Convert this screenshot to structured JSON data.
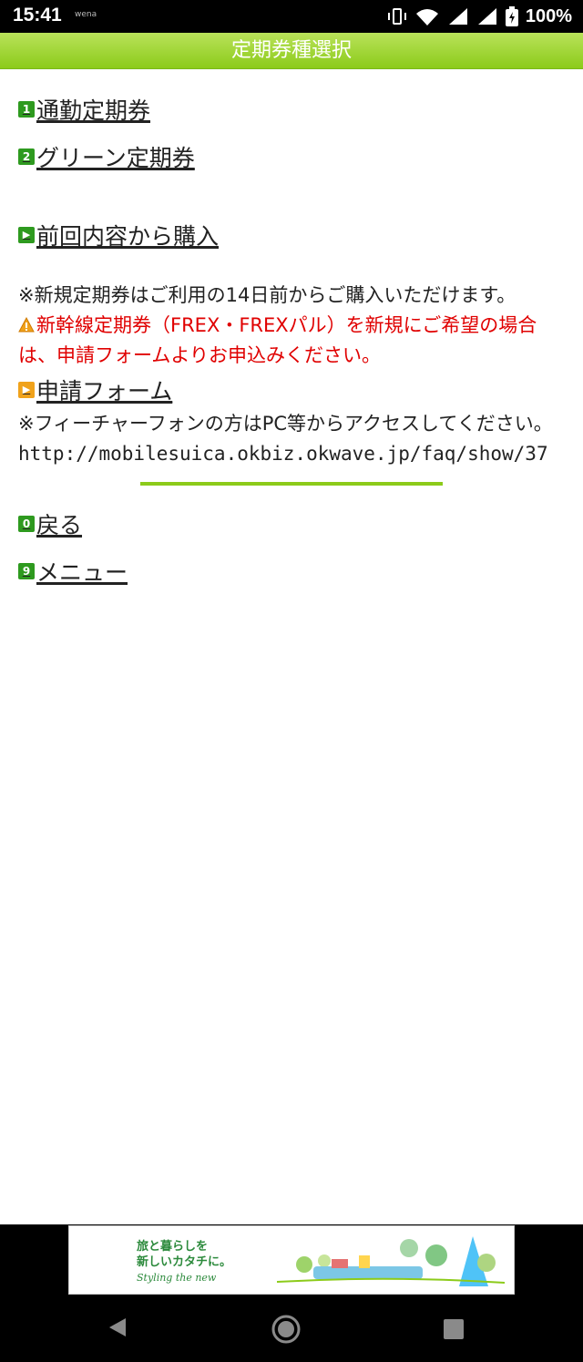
{
  "status_bar": {
    "time": "15:41",
    "tag": "wena",
    "battery": "100%"
  },
  "header": {
    "title": "定期券種選択"
  },
  "menu": {
    "items": [
      {
        "num": "1",
        "label": "通勤定期券"
      },
      {
        "num": "2",
        "label": "グリーン定期券"
      }
    ],
    "previous": {
      "label": "前回内容から購入"
    }
  },
  "notice": {
    "text": "※新規定期券はご利用の14日前からご購入いただけます。",
    "warning": "新幹線定期券（FREX・FREXパル）を新規にご希望の場合は、申請フォームよりお申込みください。",
    "form_link": "申請フォーム",
    "feature_phone": "※フィーチャーフォンの方はPC等からアクセスしてください。",
    "url": "http://mobilesuica.okbiz.okwave.jp/faq/show/37"
  },
  "footer_nav": {
    "back": {
      "num": "0",
      "label": "戻る"
    },
    "menu": {
      "num": "9",
      "label": "メニュー"
    }
  },
  "banner": {
    "line1": "旅と暮らしを",
    "line2": "新しいカタチに。",
    "sub": "Styling the new"
  },
  "icons": [
    "signal-icon",
    "wifi-icon",
    "battery-icon",
    "vibrate-icon",
    "warning-icon",
    "back-nav-icon",
    "home-nav-icon",
    "recent-apps-icon"
  ],
  "colors": {
    "accent": "#8ccb1a",
    "warning": "#e00000",
    "icon_green": "#2e9a1f",
    "icon_orange": "#f0a21b"
  }
}
